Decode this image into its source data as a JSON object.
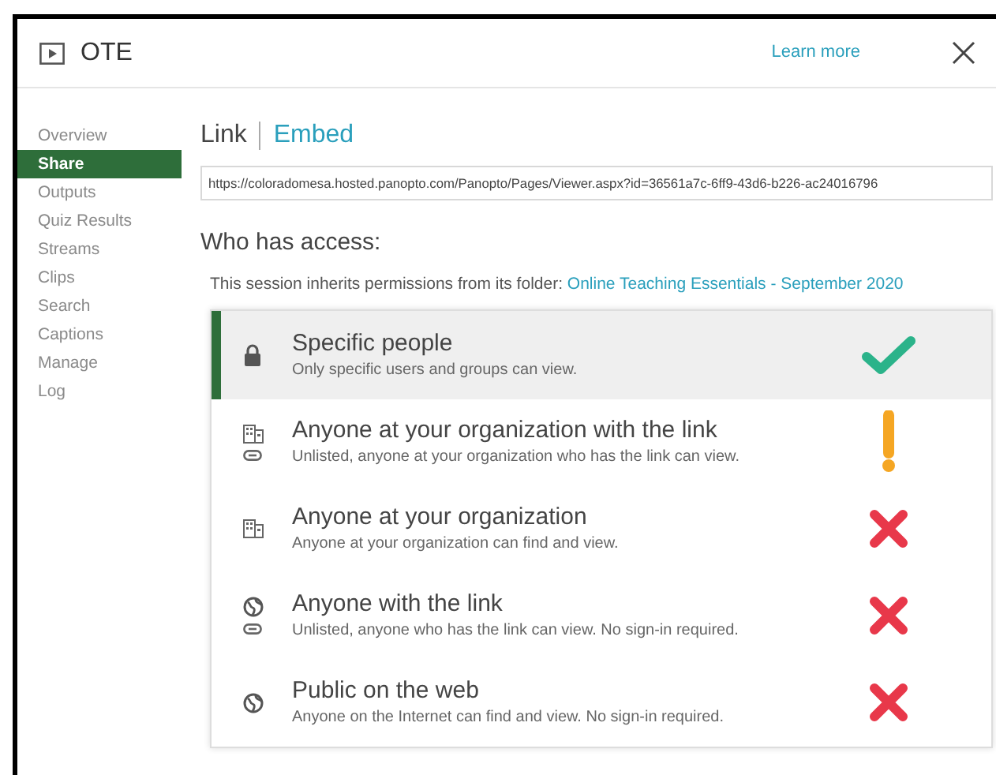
{
  "window": {
    "title": "OTE",
    "learn_more": "Learn more"
  },
  "sidebar": {
    "items": [
      {
        "label": "Overview",
        "selected": false
      },
      {
        "label": "Share",
        "selected": true
      },
      {
        "label": "Outputs",
        "selected": false
      },
      {
        "label": "Quiz Results",
        "selected": false
      },
      {
        "label": "Streams",
        "selected": false
      },
      {
        "label": "Clips",
        "selected": false
      },
      {
        "label": "Search",
        "selected": false
      },
      {
        "label": "Captions",
        "selected": false
      },
      {
        "label": "Manage",
        "selected": false
      },
      {
        "label": "Log",
        "selected": false
      }
    ]
  },
  "tabs": [
    {
      "label": "Link",
      "selected": true
    },
    {
      "label": "Embed",
      "selected": false
    }
  ],
  "link_field": {
    "value": "https://coloradomesa.hosted.panopto.com/Panopto/Pages/Viewer.aspx?id=36561a7c-6ff9-43d6-b226-ac24016796"
  },
  "access": {
    "heading": "Who has access:",
    "inherit_text": "This session inherits permissions from its folder:",
    "folder_link": "Online Teaching Essentials - September 2020",
    "options": [
      {
        "title": "Specific people",
        "description": "Only specific users and groups can view.",
        "selected": true,
        "scope": {
          "kind": "people"
        },
        "verdict": {
          "kind": "allowed"
        }
      },
      {
        "title": "Anyone at your organization with the link",
        "description": "Unlisted, anyone at your organization who has the link can view.",
        "selected": false,
        "scope": {
          "kind": "org_link"
        },
        "verdict": {
          "kind": "caution"
        }
      },
      {
        "title": "Anyone at your organization",
        "description": "Anyone at your organization can find and view.",
        "selected": false,
        "scope": {
          "kind": "org"
        },
        "verdict": {
          "kind": "denied"
        }
      },
      {
        "title": "Anyone with the link",
        "description": "Unlisted, anyone who has the link can view. No sign-in required.",
        "selected": false,
        "scope": {
          "kind": "link"
        },
        "verdict": {
          "kind": "denied"
        }
      },
      {
        "title": "Public on the web",
        "description": "Anyone on the Internet can find and view. No sign-in required.",
        "selected": false,
        "scope": {
          "kind": "public"
        },
        "verdict": {
          "kind": "denied"
        }
      }
    ]
  }
}
